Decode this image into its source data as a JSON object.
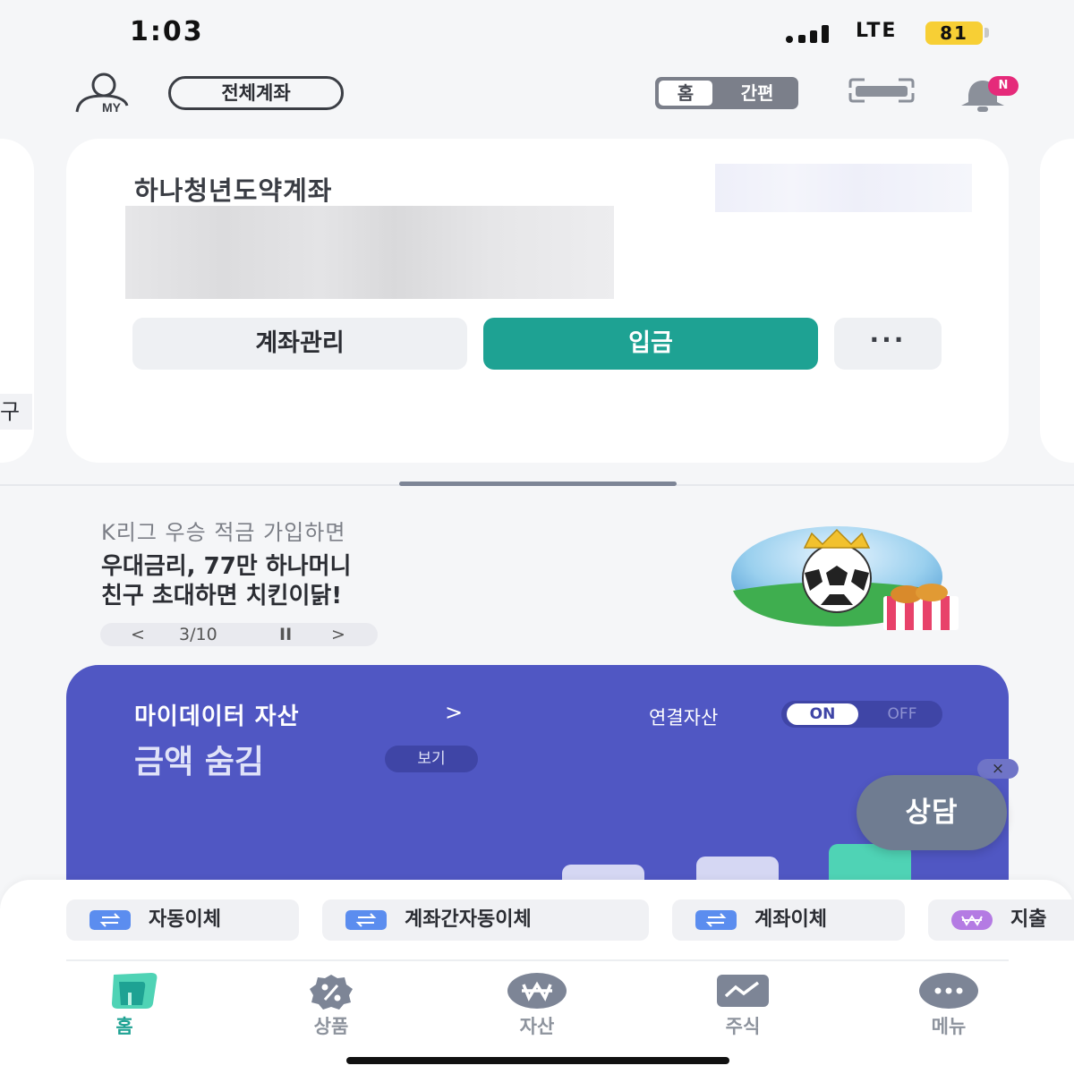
{
  "status_bar": {
    "time": "1:03",
    "network": "LTE",
    "battery": "81",
    "battery_color": "#f7cf35"
  },
  "header": {
    "my_icon": "user-icon",
    "my_label": "MY",
    "all_accounts_label": "전체계좌",
    "mode_home_label": "홈",
    "mode_simple_label": "간편",
    "scan_icon": "scan-icon",
    "bell_icon": "bell-icon",
    "bell_badge": "N"
  },
  "account_card": {
    "left_peek_text": "구",
    "account_name": "하나청년도약계좌",
    "buttons": {
      "manage": "계좌관리",
      "deposit": "입금",
      "more": "···"
    },
    "accent_color": "#1ea293"
  },
  "promo": {
    "subtitle": "K리그 우승 적금 가입하면",
    "title_line1": "우대금리, 77만 하나머니",
    "title_line2": "친구 초대하면 치킨이닭!",
    "pager": {
      "prev": "<",
      "position": "3/10",
      "pause": "II",
      "next": ">"
    },
    "image_icon": "soccer-ball-crown-chicken-image"
  },
  "mydata": {
    "title": "마이데이터 자산",
    "title_arrow": ">",
    "amount_hidden": "금액 숨김",
    "view_button": "보기",
    "linked_assets_label": "연결자산",
    "toggle_on": "ON",
    "toggle_off": "OFF",
    "toggle_state": "ON",
    "card_color": "#5057c3"
  },
  "floating": {
    "close": "×",
    "consult": "상담"
  },
  "quick_actions": [
    {
      "label": "자동이체",
      "icon": "transfer-icon",
      "color": "#5b8def"
    },
    {
      "label": "계좌간자동이체",
      "icon": "transfer-icon",
      "color": "#5b8def"
    },
    {
      "label": "계좌이체",
      "icon": "transfer-icon",
      "color": "#5b8def"
    },
    {
      "label": "지출",
      "icon": "won-icon",
      "color": "#b47be3"
    }
  ],
  "bottom_nav": {
    "items": [
      {
        "label": "홈",
        "icon": "home-icon",
        "active": true
      },
      {
        "label": "상품",
        "icon": "percent-badge-icon",
        "active": false
      },
      {
        "label": "자산",
        "icon": "won-coin-icon",
        "active": false
      },
      {
        "label": "주식",
        "icon": "chart-line-icon",
        "active": false
      },
      {
        "label": "메뉴",
        "icon": "more-dots-icon",
        "active": false
      }
    ]
  }
}
